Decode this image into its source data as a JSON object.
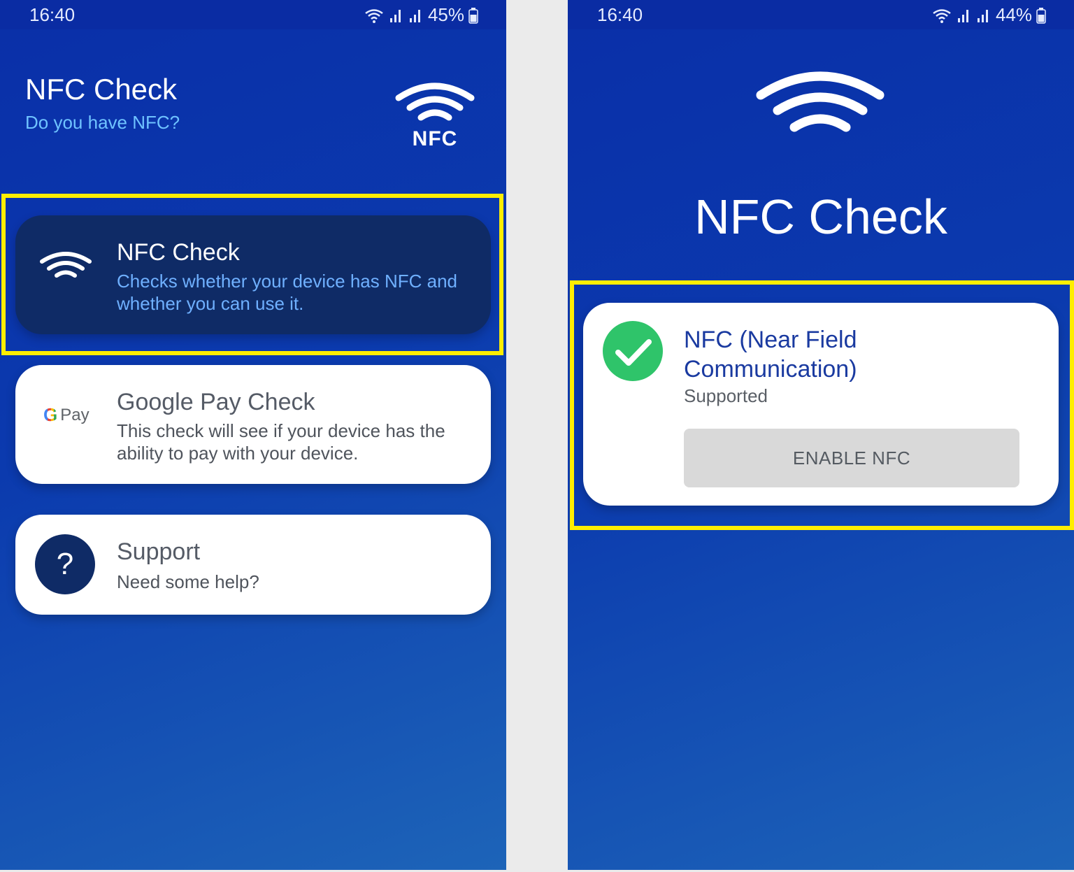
{
  "left": {
    "status": {
      "time": "16:40",
      "battery": "45%"
    },
    "header": {
      "title": "NFC Check",
      "subtitle": "Do you have NFC?",
      "logo_text": "NFC"
    },
    "cards": [
      {
        "title": "NFC Check",
        "description": "Checks whether your device has NFC and whether you can use it.",
        "icon": "nfc-waves-icon"
      },
      {
        "title": "Google Pay Check",
        "description": "This check will see if your device has the ability to pay with your device.",
        "icon": "google-pay-logo",
        "logo_g": "G",
        "logo_text": "Pay"
      },
      {
        "title": "Support",
        "description": "Need some help?",
        "icon": "question-icon",
        "icon_glyph": "?"
      }
    ]
  },
  "right": {
    "status": {
      "time": "16:40",
      "battery": "44%"
    },
    "title": "NFC Check",
    "result": {
      "title": "NFC (Near Field Communication)",
      "status": "Supported",
      "button_label": "ENABLE NFC",
      "icon": "check-icon"
    }
  },
  "colors": {
    "highlight": "#ffee00",
    "card_dark": "#0f2b66",
    "success": "#2fc46a",
    "accent_text": "#6fc3ff"
  }
}
